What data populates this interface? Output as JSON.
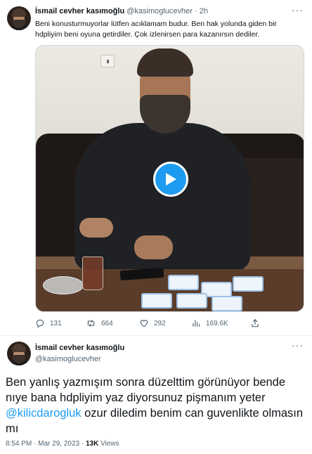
{
  "first_tweet": {
    "display_name": "İsmail cevher kasımoğlu",
    "handle": "@kasimoglucevher",
    "separator": "·",
    "time": "2h",
    "more": "···",
    "text": "Beni konusturmuyorlar lütfen acıklamam budur. Ben hak yolunda giden bir hdpliyim beni oyuna getirdiler. Çok izlenirsen para kazanırsın dediler.",
    "media": {
      "type": "video",
      "play_icon": "play-icon"
    },
    "actions": [
      {
        "name": "reply",
        "icon": "reply-icon",
        "count": "131"
      },
      {
        "name": "retweet",
        "icon": "retweet-icon",
        "count": "664"
      },
      {
        "name": "like",
        "icon": "heart-icon",
        "count": "292"
      },
      {
        "name": "views",
        "icon": "views-chart-icon",
        "count": "169.6K"
      },
      {
        "name": "share",
        "icon": "share-icon",
        "count": ""
      }
    ]
  },
  "main_tweet": {
    "display_name": "İsmail cevher kasımoğlu",
    "handle": "@kasimoglucevher",
    "more": "···",
    "text_before_mention": "Ben yanlış yazmışım sonra düzelttim görünüyor bende nıye bana hdpliyim yaz diyorsunuz pişmanım yeter ",
    "mention": "@kilicdarogluk",
    "text_after_mention": " ozur diledim benim can guvenlikte olmasın mı",
    "time": "8:54 PM",
    "separator": "·",
    "date": "Mar 29, 2023",
    "views_count": "13K",
    "views_label": "Views"
  },
  "colors": {
    "accent": "#1d9bf0",
    "text": "#0f1419",
    "secondary": "#536471",
    "border": "#eff3f4"
  }
}
